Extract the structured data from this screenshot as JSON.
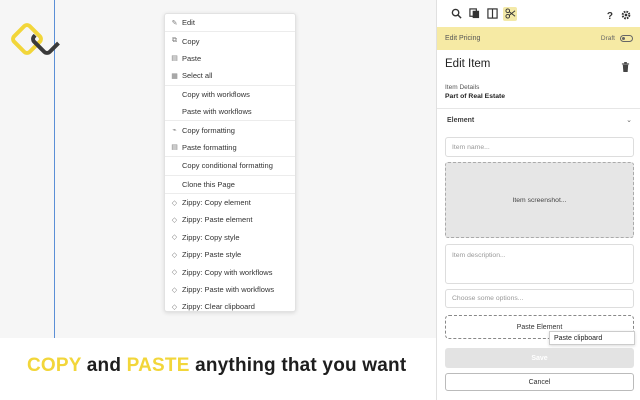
{
  "context_menu": {
    "items": [
      {
        "label": "Edit",
        "icon": "edit-icon"
      },
      {
        "label": "Copy",
        "icon": "copy-icon"
      },
      {
        "label": "Paste",
        "icon": "paste-icon"
      },
      {
        "label": "Select all",
        "icon": "select-all-icon"
      },
      {
        "label": "Copy with workflows",
        "icon": ""
      },
      {
        "label": "Paste with workflows",
        "icon": ""
      },
      {
        "label": "Copy formatting",
        "icon": "format-brush-icon"
      },
      {
        "label": "Paste formatting",
        "icon": "paste-format-icon"
      },
      {
        "label": "Copy conditional formatting",
        "icon": ""
      },
      {
        "label": "Clone this Page",
        "icon": ""
      },
      {
        "label": "Zippy: Copy element",
        "icon": "zippy-icon"
      },
      {
        "label": "Zippy: Paste element",
        "icon": "zippy-icon"
      },
      {
        "label": "Zippy: Copy style",
        "icon": "zippy-icon"
      },
      {
        "label": "Zippy: Paste style",
        "icon": "zippy-icon"
      },
      {
        "label": "Zippy: Copy with workflows",
        "icon": "zippy-icon"
      },
      {
        "label": "Zippy: Paste with workflows",
        "icon": "zippy-icon"
      },
      {
        "label": "Zippy: Clear clipboard",
        "icon": "zippy-icon"
      }
    ]
  },
  "banner": {
    "part1": "COPY",
    "part2": " and ",
    "part3": "PASTE",
    "part4": " anything that you want"
  },
  "colors": {
    "accent_yellow": "#f2d63a",
    "pricing_bg": "#f6eaa4",
    "guide_blue": "#5b8fd6"
  },
  "panel": {
    "toolbar": {
      "help": "?"
    },
    "pricing": {
      "label": "Edit Pricing",
      "status": "Draft"
    },
    "title": "Edit Item",
    "details_label": "Item Details",
    "details_value": "Part of Real Estate",
    "section": "Element",
    "item_name_placeholder": "Item name...",
    "screenshot_label": "Item screenshot...",
    "description_placeholder": "Item description...",
    "options_placeholder": "Choose some options...",
    "paste_button": "Paste Element",
    "tooltip": "Paste clipboard",
    "save_button": "Save",
    "cancel_button": "Cancel"
  }
}
